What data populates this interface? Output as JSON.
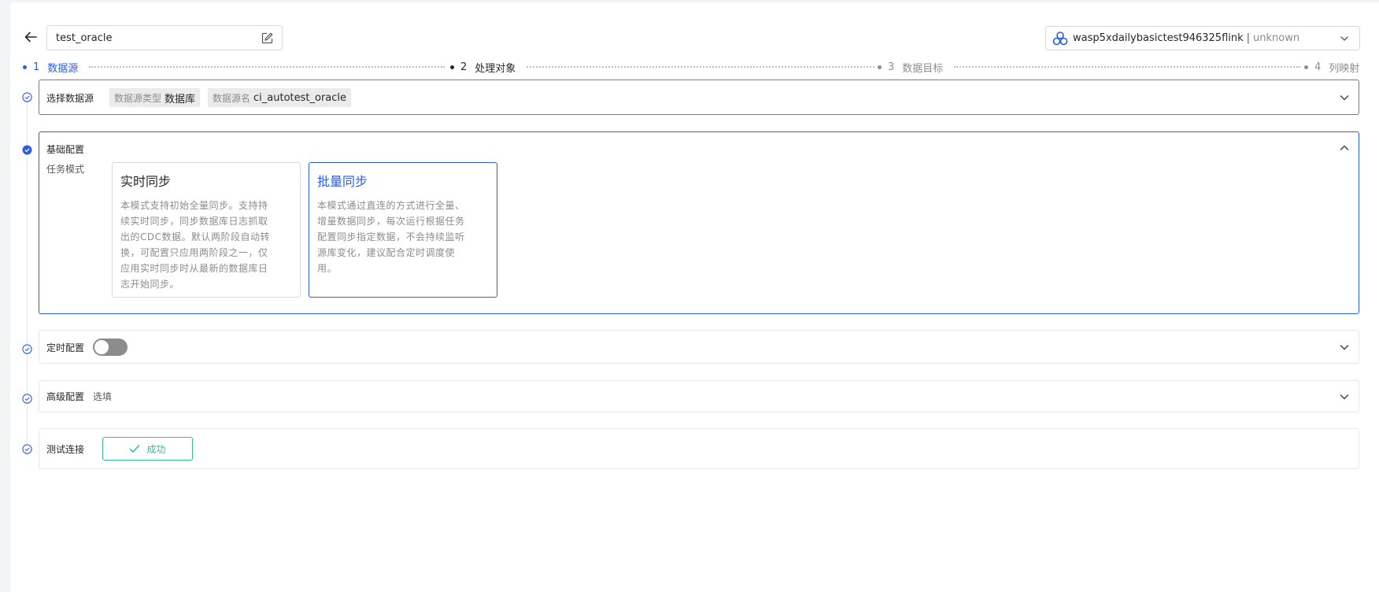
{
  "header": {
    "task_name": "test_oracle",
    "cluster_name": "wasp5xdailybasictest946325flink",
    "cluster_separator": "|",
    "cluster_status": "unknown"
  },
  "steps": [
    {
      "num": "1",
      "label": "数据源",
      "state": "active"
    },
    {
      "num": "2",
      "label": "处理对象",
      "state": "done"
    },
    {
      "num": "3",
      "label": "数据目标",
      "state": "todo"
    },
    {
      "num": "4",
      "label": "列映射",
      "state": "todo"
    }
  ],
  "source_panel": {
    "title": "选择数据源",
    "tags": [
      {
        "key": "数据源类型",
        "value": "数据库"
      },
      {
        "key": "数据源名",
        "value": "ci_autotest_oracle"
      }
    ]
  },
  "basic_panel": {
    "title": "基础配置",
    "mode_label": "任务模式",
    "cards": [
      {
        "title": "实时同步",
        "lines": [
          "本模式支持初始全量同步。支持持",
          "续实时同步，同步数据库日志抓取",
          "出的CDC数据。默认两阶段自动转",
          "换，可配置只应用两阶段之一，仅",
          "应用实时同步时从最新的数据库日",
          "志开始同步。"
        ],
        "selected": false
      },
      {
        "title": "批量同步",
        "lines": [
          "本模式通过直连的方式进行全量、",
          "增量数据同步，每次运行根据任务",
          "配置同步指定数据，不会持续监听",
          "源库变化，建议配合定时调度使",
          "用。"
        ],
        "selected": true
      }
    ]
  },
  "schedule_panel": {
    "title": "定时配置",
    "enabled": false
  },
  "advanced_panel": {
    "title": "高级配置",
    "hint": "选填"
  },
  "test_panel": {
    "title": "测试连接",
    "result_label": "成功"
  },
  "colors": {
    "accent": "#2b5ce6",
    "success": "#2ec28a",
    "muted": "#8c8c8c"
  }
}
